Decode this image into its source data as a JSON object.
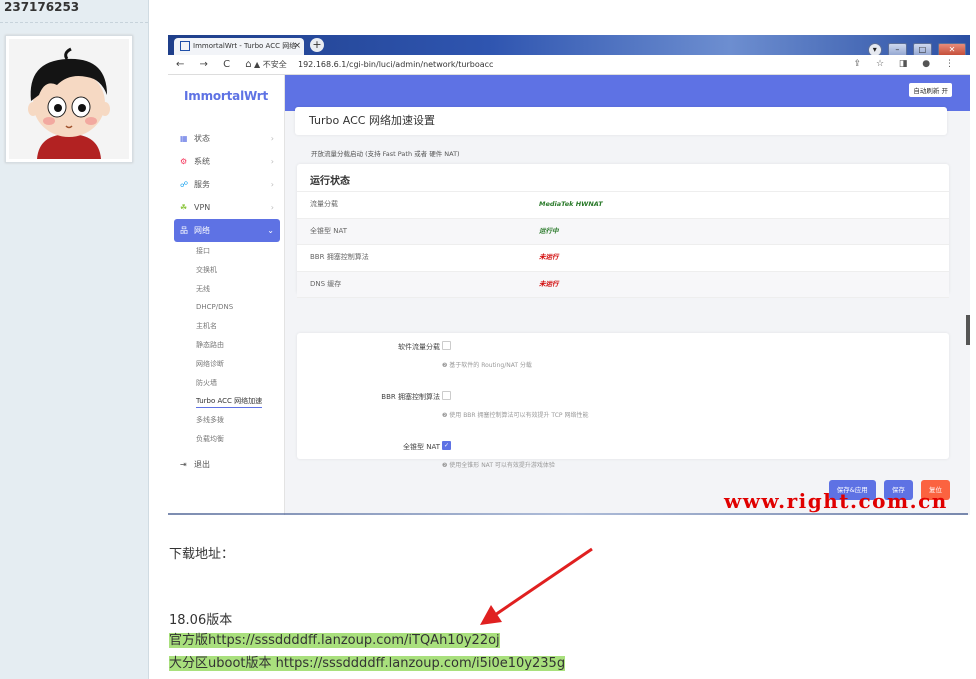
{
  "user": {
    "id": "237176253"
  },
  "browser": {
    "tab_title": "ImmortalWrt - Turbo ACC 网络",
    "tab_close": "×",
    "new_tab": "+",
    "nav_icons": "← → C ⌂",
    "security": "▲ 不安全",
    "url": "192.168.6.1/cgi-bin/luci/admin/network/turboacc",
    "right_icons": "⇪ ☆ ◨ ● ⋮",
    "win_buttons": [
      "▾",
      "–",
      "□",
      "✕"
    ]
  },
  "luci": {
    "brand": "ImmortalWrt",
    "refresh_button": "自动刷新 开",
    "menu": [
      {
        "icon": "▦",
        "label": "状态",
        "chev": "›"
      },
      {
        "icon": "⚙",
        "label": "系统",
        "chev": "›"
      },
      {
        "icon": "☍",
        "label": "服务",
        "chev": "›"
      },
      {
        "icon": "☘",
        "label": "VPN",
        "chev": "›"
      },
      {
        "icon": "品",
        "label": "网络",
        "chev": "⌄"
      }
    ],
    "submenu": [
      "接口",
      "交换机",
      "无线",
      "DHCP/DNS",
      "主机名",
      "静态路由",
      "网络诊断",
      "防火墙",
      "Turbo ACC 网络加速",
      "多线多拨",
      "负载均衡"
    ],
    "logout": {
      "icon": "⇥",
      "label": "退出"
    },
    "page_title": "Turbo ACC 网络加速设置",
    "description": "开放流量分载启动 (支持 Fast Path 或者 硬件 NAT)",
    "status_title": "运行状态",
    "status_rows": [
      {
        "key": "流量分载",
        "value": "MediaTek HWNAT",
        "color": "#2a7a2a"
      },
      {
        "key": "全锥型 NAT",
        "value": "运行中",
        "color": "#2a7a2a"
      },
      {
        "key": "BBR 拥塞控制算法",
        "value": "未运行",
        "color": "#d00000"
      },
      {
        "key": "DNS 缓存",
        "value": "未运行",
        "color": "#d00000"
      }
    ],
    "options": [
      {
        "label": "软件流量分载",
        "checked": false,
        "help": "❷ 基于软件的 Routing/NAT 分载"
      },
      {
        "label": "BBR 拥塞控制算法",
        "checked": false,
        "help": "❷ 使用 BBR 拥塞控制算法可以有效提升 TCP 网络性能"
      },
      {
        "label": "全锥型 NAT",
        "checked": true,
        "help": "❷ 使用全锥形 NAT 可以有效提升游戏体验"
      }
    ],
    "buttons": {
      "save_apply": "保存&应用",
      "save": "保存",
      "reset": "复位"
    }
  },
  "watermark": "www.right.com.cn",
  "post": {
    "download_label": "下载地址：",
    "version": "18.06版本",
    "line1_prefix": "官方版",
    "line1_url": "https://sssddddff.lanzoup.com/iTQAh10y22oj",
    "line2_prefix": "大分区uboot版本 ",
    "line2_url": "https://sssddddff.lanzoup.com/i5i0e10y235g"
  }
}
